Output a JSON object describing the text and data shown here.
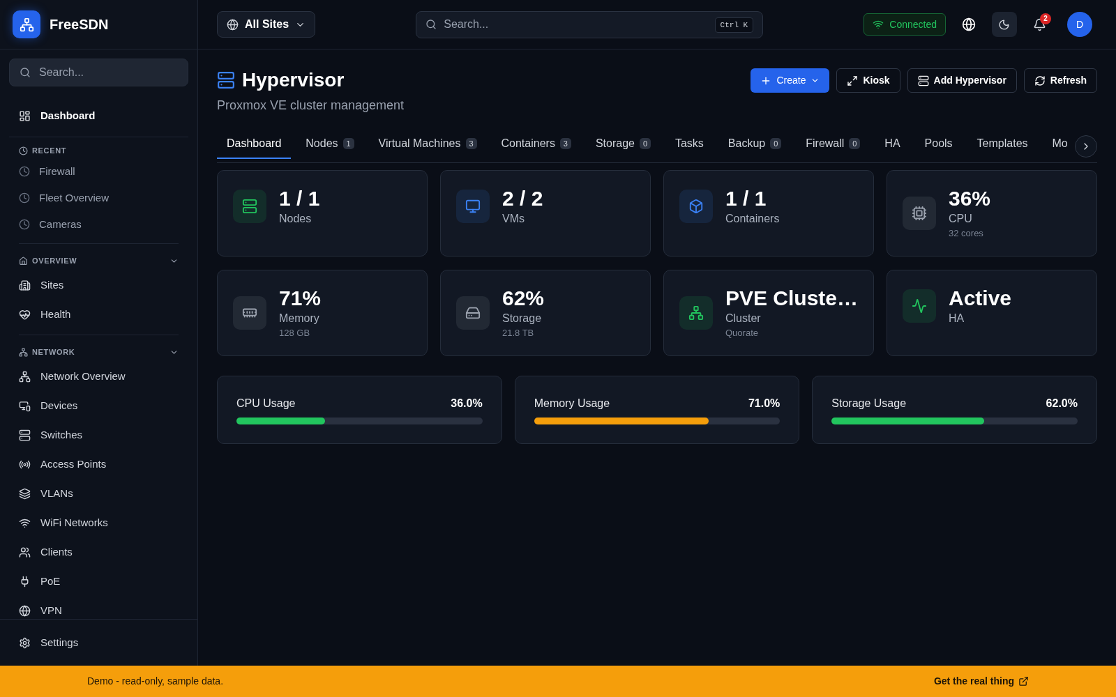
{
  "sidebar": {
    "brand": "FreeSDN",
    "search": {
      "placeholder": "Search..."
    },
    "home": "Dashboard",
    "sections": [
      {
        "kind": "recent",
        "title": "RECENT",
        "items": [
          "Firewall",
          "Fleet Overview",
          "Cameras"
        ]
      },
      {
        "kind": "group",
        "title": "OVERVIEW",
        "expanded": true,
        "items": [
          "Sites",
          "Health"
        ]
      },
      {
        "kind": "group",
        "title": "NETWORK",
        "expanded": true,
        "items": [
          "Network Overview",
          "Devices",
          "Switches",
          "Access Points",
          "VLANs",
          "WiFi Networks",
          "Clients",
          "PoE",
          "VPN"
        ]
      }
    ],
    "footer": "Settings"
  },
  "topbar": {
    "site_selector": "All Sites",
    "search": {
      "placeholder": "Search...",
      "shortcut": "Ctrl K"
    },
    "connection": "Connected",
    "notification_count": "2",
    "avatar_initial": "D"
  },
  "page": {
    "title": "Hypervisor",
    "subtitle": "Proxmox VE cluster management",
    "actions": [
      {
        "label": "Create",
        "kind": "primary"
      },
      {
        "label": "Kiosk",
        "kind": "outline"
      },
      {
        "label": "Add Hypervisor",
        "kind": "outline"
      },
      {
        "label": "Refresh",
        "kind": "outline"
      }
    ],
    "tabs": [
      {
        "label": "Dashboard",
        "selected": true
      },
      {
        "label": "Nodes",
        "count": "1",
        "selected": false
      },
      {
        "label": "Virtual Machines",
        "count": "3",
        "selected": false
      },
      {
        "label": "Containers",
        "count": "3",
        "selected": false
      },
      {
        "label": "Storage",
        "count": "0",
        "selected": false
      },
      {
        "label": "Tasks",
        "selected": false
      },
      {
        "label": "Backup",
        "count": "0",
        "selected": false
      },
      {
        "label": "Firewall",
        "count": "0",
        "selected": false
      },
      {
        "label": "HA",
        "selected": false
      },
      {
        "label": "Pools",
        "selected": false
      },
      {
        "label": "Templates",
        "selected": false
      },
      {
        "label": "Mo",
        "selected": false
      }
    ]
  },
  "stats": [
    {
      "value": "1 / 1",
      "label": "Nodes",
      "color": "#22c55e"
    },
    {
      "value": "2 / 2",
      "label": "VMs",
      "color": "#3b82f6"
    },
    {
      "value": "1 / 1",
      "label": "Containers",
      "color": "#3b82f6"
    },
    {
      "value": "36%",
      "label": "CPU",
      "detail": "32 cores",
      "color": "#9ca3af"
    },
    {
      "value": "71%",
      "label": "Memory",
      "detail": "128 GB",
      "color": "#9ca3af"
    },
    {
      "value": "62%",
      "label": "Storage",
      "detail": "21.8 TB",
      "color": "#9ca3af"
    },
    {
      "value": "PVE Cluste…",
      "label": "Cluster",
      "detail": "Quorate",
      "color": "#22c55e"
    },
    {
      "value": "Active",
      "label": "HA",
      "color": "#22c55e"
    }
  ],
  "usage": [
    {
      "label": "CPU Usage",
      "reading": "36.0%",
      "level": 0.36,
      "color": "#22c55e"
    },
    {
      "label": "Memory Usage",
      "reading": "71.0%",
      "level": 0.71,
      "color": "#f59e0b"
    },
    {
      "label": "Storage Usage",
      "reading": "62.0%",
      "level": 0.62,
      "color": "#22c55e"
    }
  ],
  "banner": {
    "message": "Demo - read-only, sample data.",
    "link": "Get the real thing"
  }
}
